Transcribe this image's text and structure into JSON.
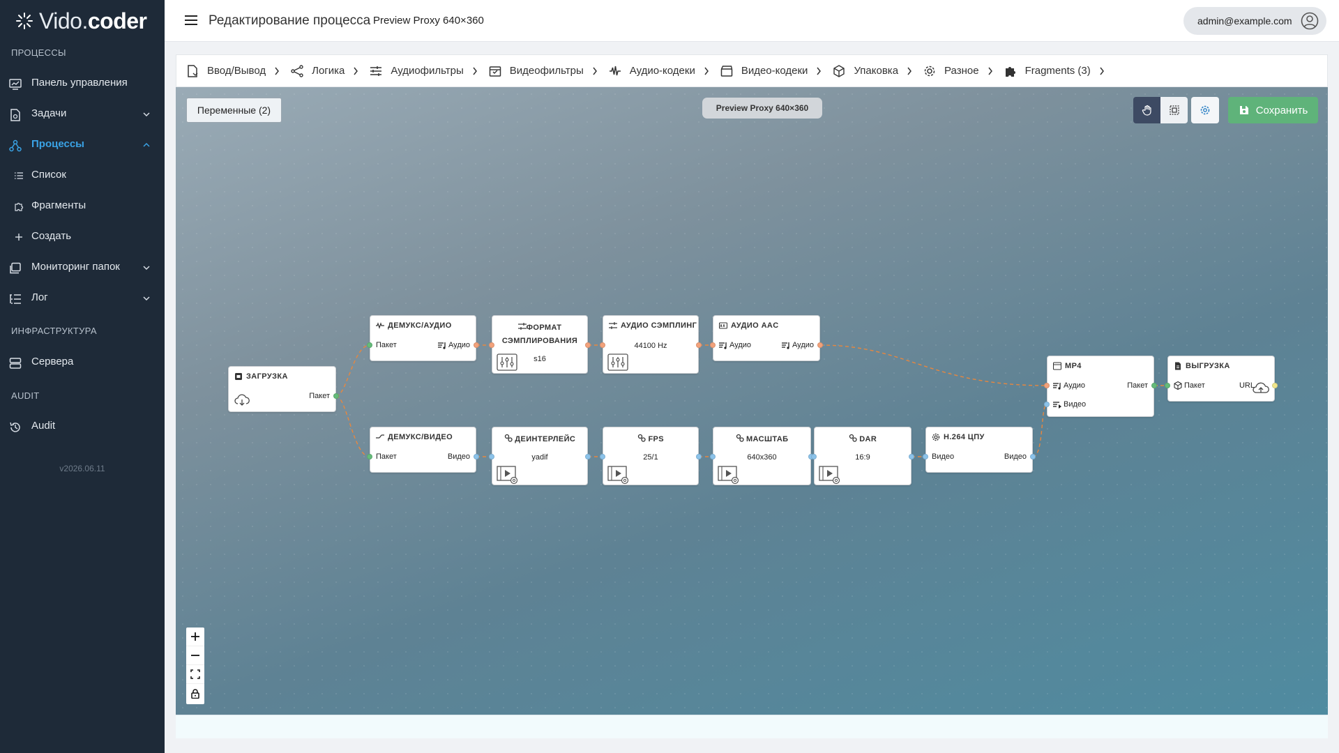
{
  "brand": {
    "name_light": "Vido.",
    "name_bold": "coder"
  },
  "sidebar": {
    "sections": {
      "processes": "ПРОЦЕССЫ",
      "infra": "ИНФРАСТРУКТУРА",
      "audit": "AUDIT"
    },
    "items": {
      "dashboard": "Панель управления",
      "tasks": "Задачи",
      "processes": "Процессы",
      "list": "Список",
      "fragments": "Фрагменты",
      "create": "Создать",
      "monitoring": "Мониторинг папок",
      "log": "Лог",
      "servers": "Сервера",
      "audit": "Audit"
    },
    "version": "v2026.06.11"
  },
  "header": {
    "title": "Редактирование процесса",
    "subtitle": "Preview Proxy 640×360",
    "user": "admin@example.com"
  },
  "crumbs": [
    "Ввод/Вывод",
    "Логика",
    "Аудиофильтры",
    "Видеофильтры",
    "Аудио-кодеки",
    "Видео-кодеки",
    "Упаковка",
    "Разное",
    "Fragments (3)"
  ],
  "canvas": {
    "variables_button": "Переменные (2)",
    "process_title": "Preview Proxy 640×360",
    "save_label": "Сохранить"
  },
  "nodes": {
    "upload": {
      "title": "ЗАГРУЗКА",
      "out": "Пакет"
    },
    "demux_audio": {
      "title": "ДЕМУКС/АУДИО",
      "in": "Пакет",
      "out": "Аудио"
    },
    "sample_fmt": {
      "title": "ФОРМАТ СЭМПЛИРОВАНИЯ",
      "value": "s16"
    },
    "resample": {
      "title": "АУДИО СЭМПЛИНГ",
      "value": "44100 Hz"
    },
    "aac": {
      "title": "АУДИО AAC",
      "in": "Аудио",
      "out": "Аудио"
    },
    "demux_video": {
      "title": "ДЕМУКС/ВИДЕО",
      "in": "Пакет",
      "out": "Видео"
    },
    "deinterlace": {
      "title": "ДЕИНТЕРЛЕЙС",
      "value": "yadif"
    },
    "fps": {
      "title": "FPS",
      "value": "25/1"
    },
    "scale": {
      "title": "МАСШТАБ",
      "value": "640x360"
    },
    "dar": {
      "title": "DAR",
      "value": "16:9"
    },
    "h264": {
      "title": "H.264 ЦПУ",
      "in": "Видео",
      "out": "Видео"
    },
    "mp4": {
      "title": "MP4",
      "in_audio": "Аудио",
      "in_video": "Видео",
      "out": "Пакет"
    },
    "export": {
      "title": "ВЫГРУЗКА",
      "in": "Пакет",
      "out": "URL"
    }
  },
  "colors": {
    "sidebar": "#1e2a38",
    "active": "#3aa3e6",
    "save": "#5fb37a",
    "edge": "#e8873e",
    "packet": "#65bb7a",
    "audio": "#f3a27b",
    "video": "#8cc3ea"
  }
}
